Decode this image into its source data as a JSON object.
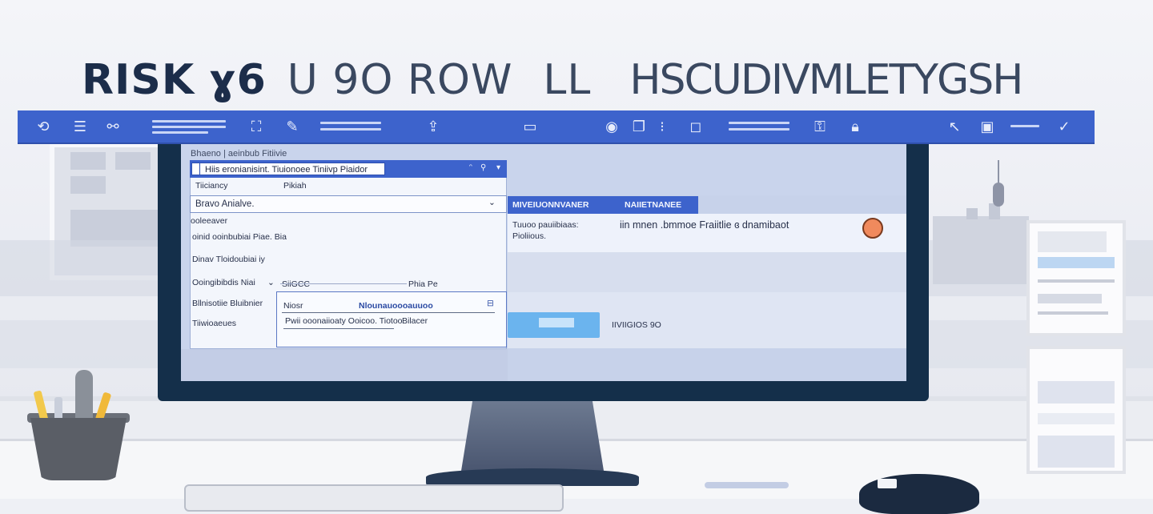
{
  "headline": {
    "part1": "RISK",
    "part2": "ɣ6",
    "part3": "U 9O ROW",
    "part4": "LL",
    "part5": "HSCUDIVMLETYGSH"
  },
  "colors": {
    "toolbar_blue": "#3d63cc",
    "monitor_frame": "#142f4a",
    "screen_bg": "#c9d4ec",
    "accent_button": "#6bb4ee",
    "avatar": "#f08a5d"
  },
  "toolbar": {
    "icons": [
      "refresh-icon",
      "list-icon",
      "link-icon",
      "image-icon",
      "edit-icon",
      "upload-icon",
      "window-icon",
      "camera-icon",
      "copy-icon",
      "open-icon",
      "lock-icon",
      "unlock-icon",
      "cursor-icon",
      "folder-icon",
      "check-icon"
    ]
  },
  "screen": {
    "breadcrumb": "Bhaeno | aeinbub Fitiivie",
    "window_title": "Hiis eronianisint. Tiuionoee Tiniivp Piaidor",
    "window_controls": [
      "ᵔ",
      "⚲",
      "▾"
    ],
    "row_label_1": "Tiiciancy",
    "row_value_1": "Pikiah",
    "dropdown_value": "Bravo Anialve.",
    "row_label_2": "ooleeaver",
    "row_label_3": "oinid ooinbubiai Piae. Bia",
    "row_label_4": "Dinav Tloidoubiai iy",
    "row_label_5": "Ooingibibdis Niai",
    "row_select": "SiiGCC",
    "row_select_right": "Phia Pe",
    "row_label_6": "Bllnisotiie Bluibnier",
    "row_label_7": "Tiiwioaeues",
    "subpanel": {
      "label": "Niosr",
      "title": "Nlounauoooauuoo",
      "input_value": "Pwii ooonaiioaty Ooicoo. Tiotoo",
      "input_right": "Bilacer"
    },
    "right_panel": {
      "header_left": "MIVEIUONNVANER",
      "header_right": "NAIIETNANEE",
      "row1_left_line1": "Tuuoo pauiibiaas:",
      "row1_left_line2": "Pioliious.",
      "row1_main": "iin mnen .bmmoe Fraiitlie ɞ dnamibaot",
      "action_label": "IIVIIGIOS 9O"
    }
  }
}
